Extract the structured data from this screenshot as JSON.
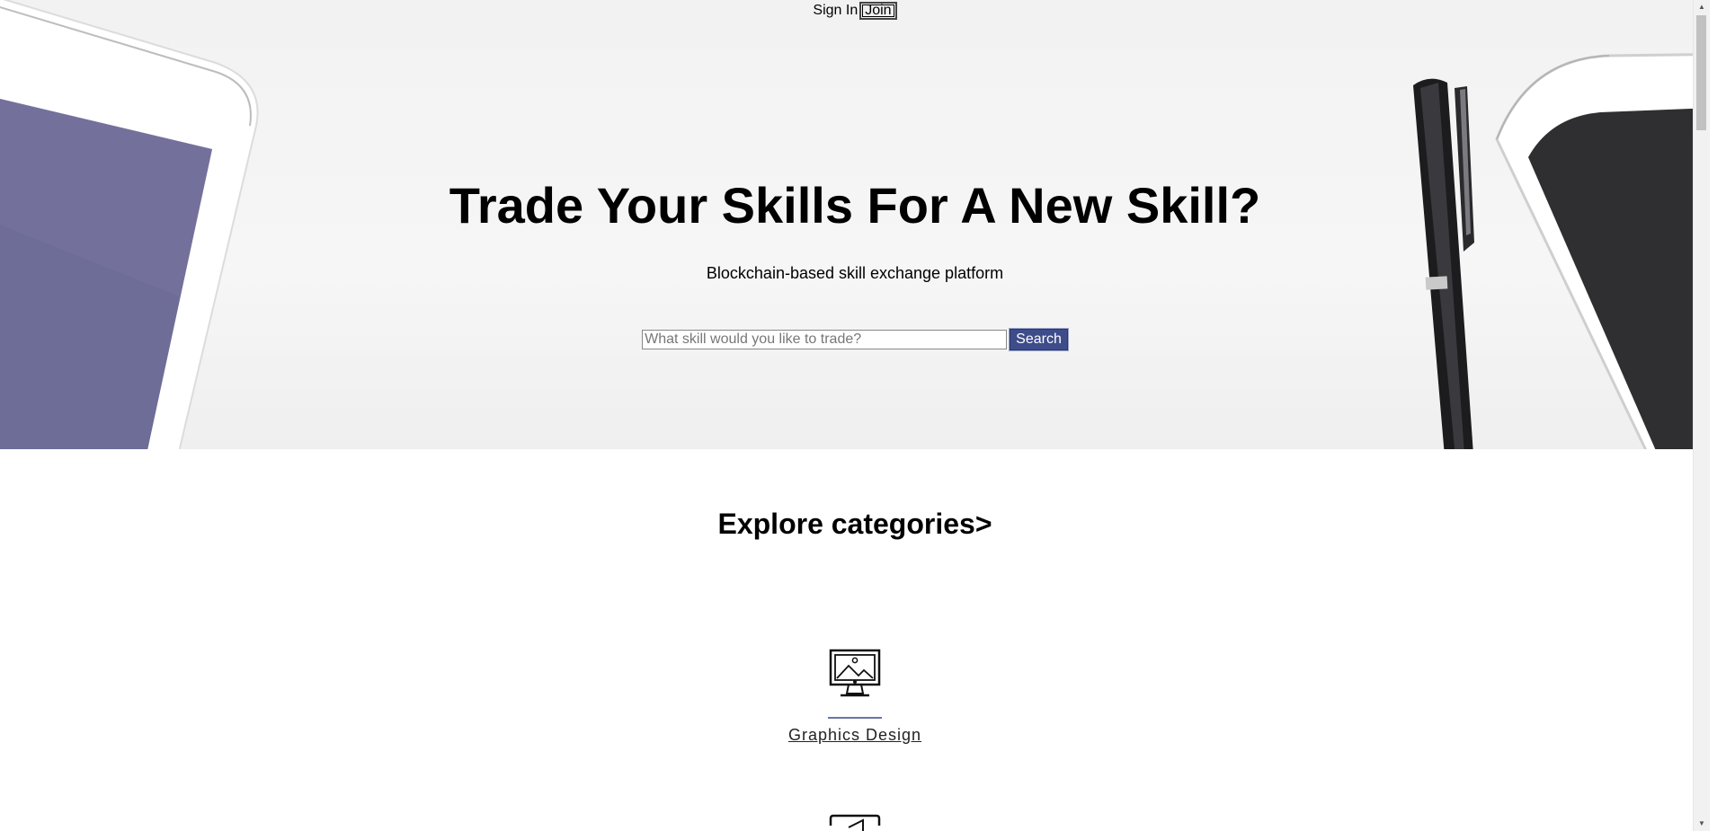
{
  "nav": {
    "signin_label": "Sign In",
    "join_label": "Join"
  },
  "hero": {
    "title": "Trade Your Skills For A New Skill?",
    "subtitle": "Blockchain-based skill exchange platform",
    "search_placeholder": "What skill would you like to trade?",
    "search_value": "",
    "search_button_label": "Search"
  },
  "categories": {
    "heading": "Explore categories>",
    "items": [
      {
        "label": "Graphics Design",
        "icon": "monitor-image-icon"
      },
      {
        "label": "",
        "icon": "megaphone-icon"
      }
    ]
  },
  "colors": {
    "search_button_bg": "#3e4d8a",
    "category_rule": "#6b74a8",
    "tablet_screen": "#6e6d97",
    "phone_screen": "#2f2f31"
  }
}
